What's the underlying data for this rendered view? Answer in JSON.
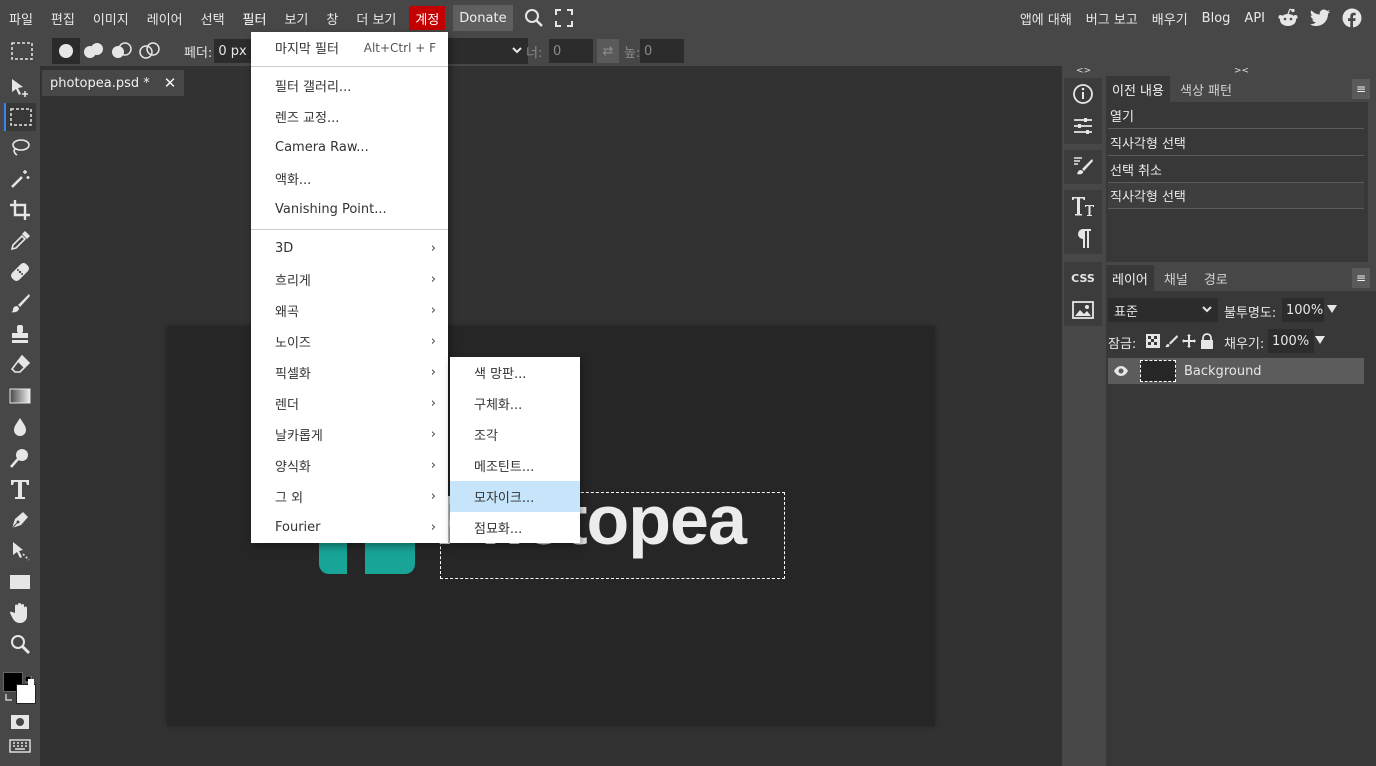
{
  "menubar": {
    "items": [
      "파일",
      "편집",
      "이미지",
      "레이어",
      "선택",
      "필터",
      "보기",
      "창",
      "더 보기"
    ],
    "account": "계정",
    "donate": "Donate",
    "right_links": [
      "앱에 대해",
      "버그 보고",
      "배우기",
      "Blog",
      "API"
    ]
  },
  "options": {
    "feather_label": "페더:",
    "feather_value": "0 px",
    "width_label": "너:",
    "width_value": "0",
    "height_label": "높:",
    "height_value": "0",
    "swap_glyph": "⇄"
  },
  "document": {
    "tab_title": "photopea.psd *",
    "close_glyph": "✕",
    "logo_text": "Photopea"
  },
  "filter_menu": {
    "last_filter": "마지막 필터",
    "last_filter_shortcut": "Alt+Ctrl + F",
    "group1": [
      "필터 갤러리...",
      "렌즈 교정...",
      "Camera Raw...",
      "액화...",
      "Vanishing Point..."
    ],
    "group2": [
      "3D",
      "흐리게",
      "왜곡",
      "노이즈",
      "픽셀화",
      "렌더",
      "날카롭게",
      "양식화",
      "그 외",
      "Fourier"
    ],
    "arrow": "›"
  },
  "pixelate_submenu": {
    "items": [
      "색 망판...",
      "구체화...",
      "조각",
      "메조틴트...",
      "모자이크...",
      "점묘화..."
    ],
    "highlighted": "모자이크..."
  },
  "iconcol": {
    "css_label": "CSS",
    "info_icon": "info-icon",
    "collapse_left": "<>",
    "collapse_right": "><"
  },
  "history_panel": {
    "tabs": [
      "이전 내용",
      "색상 패턴"
    ],
    "menu_glyph": "≡",
    "items": [
      "열기",
      "직사각형 선택",
      "선택 취소",
      "직사각형 선택"
    ]
  },
  "layers_panel": {
    "tabs": [
      "레이어",
      "채널",
      "경로"
    ],
    "menu_glyph": "≡",
    "blend_mode": "표준",
    "opacity_label": "불투명도:",
    "opacity_value": "100%",
    "lock_label": "잠금:",
    "fill_label": "채우기:",
    "fill_value": "100%",
    "layers": [
      {
        "name": "Background"
      }
    ]
  },
  "colors": {
    "accent": "#3b83f7",
    "account_red": "#c40000",
    "logo_teal": "#18a497",
    "menu_hover": "#c6e5fb"
  }
}
